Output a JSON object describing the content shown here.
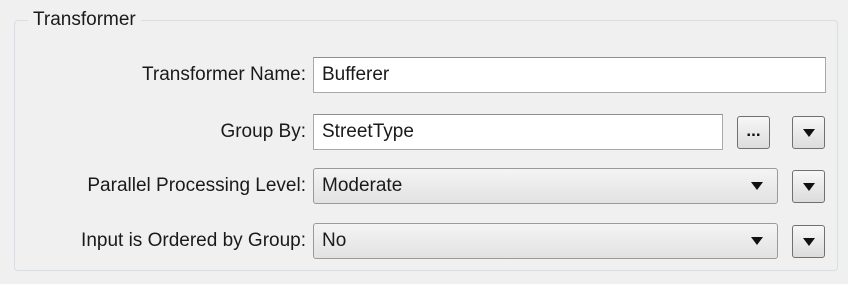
{
  "group": {
    "title": "Transformer"
  },
  "fields": {
    "transformer_name": {
      "label": "Transformer Name:",
      "value": "Bufferer"
    },
    "group_by": {
      "label": "Group By:",
      "value": "StreetType",
      "browse_label": "..."
    },
    "parallel_processing": {
      "label": "Parallel Processing Level:",
      "value": "Moderate"
    },
    "input_ordered": {
      "label": "Input is Ordered by Group:",
      "value": "No"
    }
  },
  "icons": {
    "dropdown": "chevron-down-icon",
    "browse": "ellipsis-icon"
  }
}
